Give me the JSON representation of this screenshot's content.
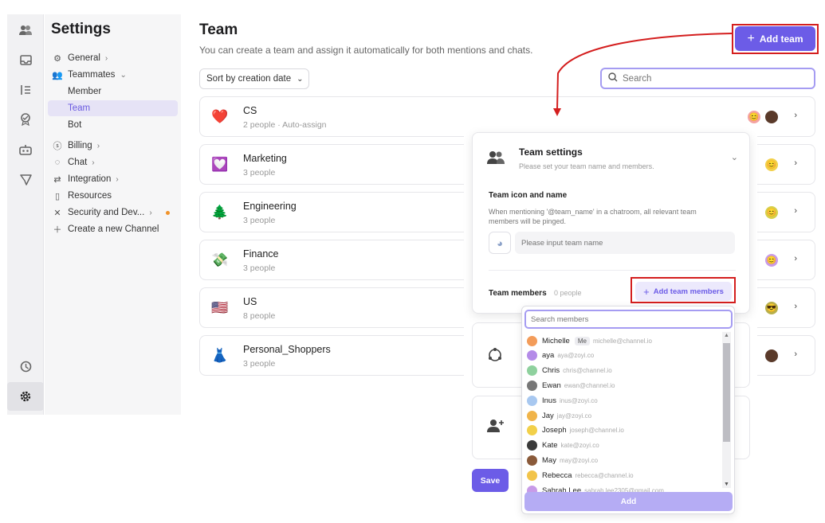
{
  "rail": {
    "icons": [
      "people-icon",
      "inbox-icon",
      "list-icon",
      "badge-icon",
      "bot-icon",
      "send-icon",
      "clock-icon",
      "gear-icon"
    ]
  },
  "sidebar": {
    "title": "Settings",
    "items": [
      {
        "label": "General",
        "icon": "gear-icon"
      },
      {
        "label": "Teammates",
        "icon": "people-icon"
      },
      {
        "label": "Member"
      },
      {
        "label": "Team"
      },
      {
        "label": "Bot"
      },
      {
        "label": "Billing",
        "icon": "dollar-icon"
      },
      {
        "label": "Chat",
        "icon": "chat-icon"
      },
      {
        "label": "Integration",
        "icon": "swap-icon"
      },
      {
        "label": "Resources",
        "icon": "book-icon"
      },
      {
        "label": "Security and Dev...",
        "icon": "tools-icon"
      },
      {
        "label": "Create a new Channel",
        "icon": "plus-icon"
      }
    ]
  },
  "main": {
    "title": "Team",
    "subtitle": "You can create a team and assign it automatically for both mentions and chats.",
    "sort_label": "Sort by creation date",
    "add_team_label": "Add team",
    "search_placeholder": "Search"
  },
  "teams": [
    {
      "name": "CS",
      "meta": "2 people",
      "extra": "Auto-assign",
      "emoji": "❤️"
    },
    {
      "name": "Marketing",
      "meta": "3 people",
      "emoji": "💟"
    },
    {
      "name": "Engineering",
      "meta": "3 people",
      "emoji": "🌲"
    },
    {
      "name": "Finance",
      "meta": "3 people",
      "emoji": "💸"
    },
    {
      "name": "US",
      "meta": "8 people",
      "emoji": "🇺🇸"
    },
    {
      "name": "Personal_Shoppers",
      "meta": "3 people",
      "emoji": "👗"
    }
  ],
  "panel": {
    "title": "Team settings",
    "subtitle": "Please set your team name and members.",
    "icon_name_title": "Team icon and name",
    "description": "When mentioning '@team_name' in a chatroom, all relevant team members will be pinged.",
    "name_placeholder": "Please input team name",
    "members_title": "Team members",
    "members_count": "0 people",
    "add_members_label": "Add team members",
    "save_label": "Save"
  },
  "dropdown": {
    "search_placeholder": "Search members",
    "me_tag": "Me",
    "add_label": "Add",
    "members": [
      {
        "name": "Michelle",
        "email": "michelle@channel.io",
        "color": "#f39c5a"
      },
      {
        "name": "aya",
        "email": "aya@zoyi.co",
        "color": "#b48be8"
      },
      {
        "name": "Chris",
        "email": "chris@channel.io",
        "color": "#8fd19e"
      },
      {
        "name": "Ewan",
        "email": "ewan@channel.io",
        "color": "#777777"
      },
      {
        "name": "Inus",
        "email": "inus@zoyi.co",
        "color": "#a8c8f0"
      },
      {
        "name": "Jay",
        "email": "jay@zoyi.co",
        "color": "#f0b44a"
      },
      {
        "name": "Joseph",
        "email": "joseph@channel.io",
        "color": "#f2d04a"
      },
      {
        "name": "Kate",
        "email": "kate@zoyi.co",
        "color": "#3a3a3a"
      },
      {
        "name": "May",
        "email": "may@zoyi.co",
        "color": "#8a5a3a"
      },
      {
        "name": "Rebecca",
        "email": "rebecca@channel.io",
        "color": "#f2c44a"
      },
      {
        "name": "Sahrah Lee",
        "email": "sahrah.lee2305@gmail.com",
        "color": "#c89be8"
      }
    ]
  },
  "colors": {
    "accent": "#6c5ce7",
    "highlight_frame": "#d41e1e"
  }
}
